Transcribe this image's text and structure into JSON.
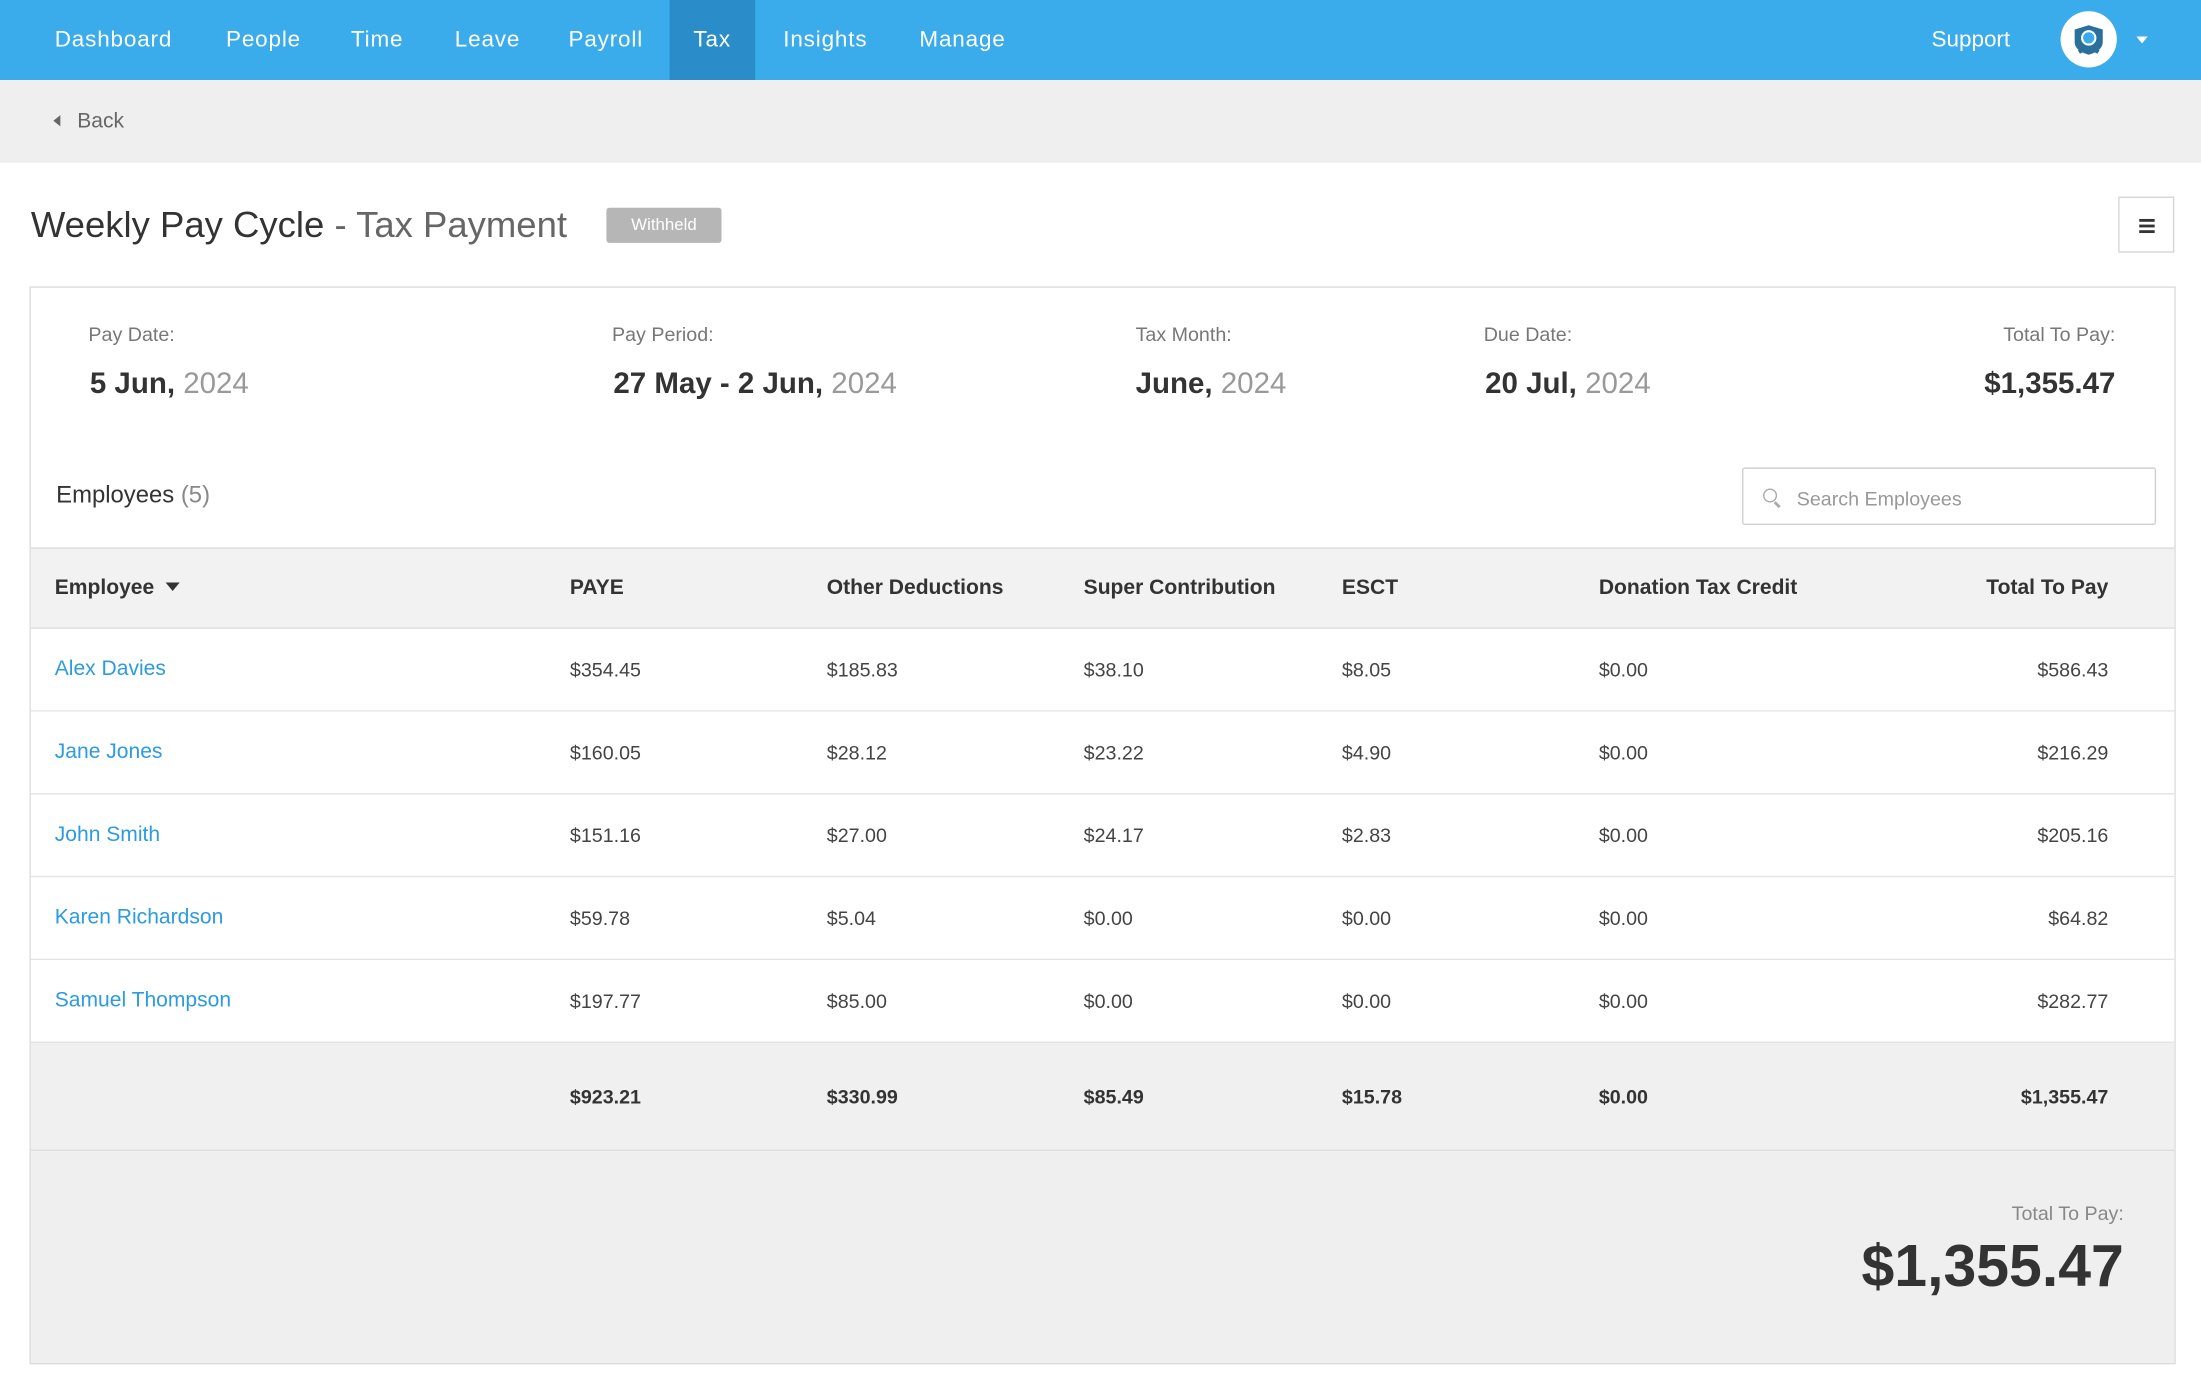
{
  "nav": {
    "items": [
      "Dashboard",
      "People",
      "Time",
      "Leave",
      "Payroll",
      "Tax",
      "Insights",
      "Manage"
    ],
    "active": "Tax",
    "support": "Support"
  },
  "back": {
    "label": "Back"
  },
  "page": {
    "title": "Weekly Pay Cycle",
    "subtitle": " - Tax Payment",
    "status": "Withheld"
  },
  "summary": {
    "pay_date": {
      "label": "Pay Date:",
      "main": "5 Jun,",
      "year": " 2024"
    },
    "pay_period": {
      "label": "Pay Period:",
      "main": "27 May - 2 Jun,",
      "year": " 2024"
    },
    "tax_month": {
      "label": "Tax Month:",
      "main": "June,",
      "year": " 2024"
    },
    "due_date": {
      "label": "Due Date:",
      "main": "20 Jul,",
      "year": " 2024"
    },
    "total": {
      "label": "Total To Pay:",
      "value": "$1,355.47"
    }
  },
  "employees": {
    "heading": "Employees",
    "count": "(5)",
    "search_placeholder": "Search Employees"
  },
  "table": {
    "columns": [
      "Employee",
      "PAYE",
      "Other Deductions",
      "Super Contribution",
      "ESCT",
      "Donation Tax Credit",
      "Total To Pay"
    ],
    "rows": [
      [
        "Alex Davies",
        "$354.45",
        "$185.83",
        "$38.10",
        "$8.05",
        "$0.00",
        "$586.43"
      ],
      [
        "Jane Jones",
        "$160.05",
        "$28.12",
        "$23.22",
        "$4.90",
        "$0.00",
        "$216.29"
      ],
      [
        "John Smith",
        "$151.16",
        "$27.00",
        "$24.17",
        "$2.83",
        "$0.00",
        "$205.16"
      ],
      [
        "Karen Richardson",
        "$59.78",
        "$5.04",
        "$0.00",
        "$0.00",
        "$0.00",
        "$64.82"
      ],
      [
        "Samuel Thompson",
        "$197.77",
        "$85.00",
        "$0.00",
        "$0.00",
        "$0.00",
        "$282.77"
      ]
    ],
    "totals": [
      "",
      "$923.21",
      "$330.99",
      "$85.49",
      "$15.78",
      "$0.00",
      "$1,355.47"
    ]
  },
  "footer": {
    "label": "Total To Pay:",
    "value": "$1,355.47"
  },
  "icons": {
    "back": "chevron-left-icon",
    "menu": "hamburger-menu-icon",
    "search": "search-icon",
    "sort": "sort-down-icon",
    "avatar": "user-avatar-icon",
    "dropdown": "caret-down-icon"
  },
  "colors": {
    "nav_bg": "#3aabeb",
    "nav_active": "#2a8cc8",
    "link": "#2c9be0",
    "badge": "#b6b6b6"
  }
}
